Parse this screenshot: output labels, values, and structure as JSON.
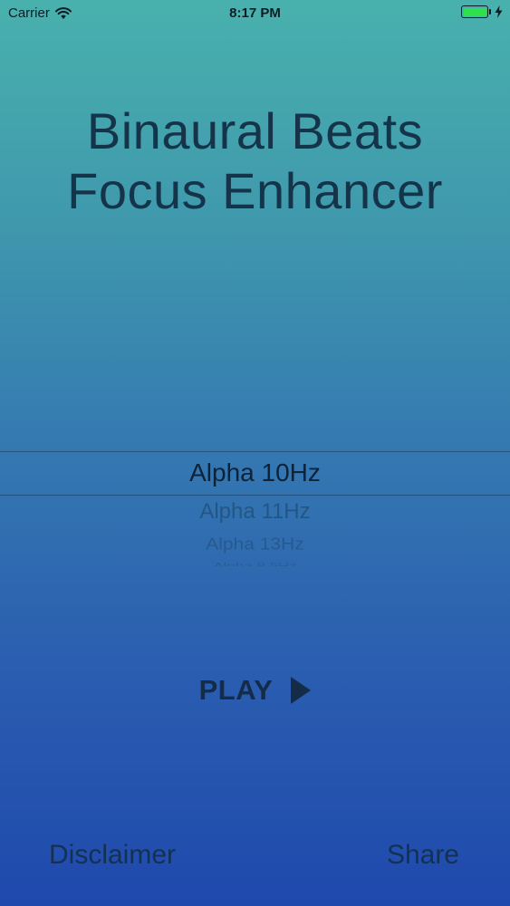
{
  "status_bar": {
    "carrier": "Carrier",
    "time": "8:17 PM",
    "battery_level": 1.0,
    "battery_color": "#2ee04a",
    "icons": [
      "wifi-icon",
      "battery-icon",
      "charging-bolt-icon"
    ]
  },
  "title": {
    "line1": "Binaural Beats",
    "line2": "Focus Enhancer"
  },
  "picker": {
    "selected": "Alpha 10Hz",
    "items": [
      "Alpha 10Hz",
      "Alpha 11Hz",
      "Alpha 13Hz",
      "Alpha 8.5Hz"
    ]
  },
  "play": {
    "label": "PLAY",
    "icon": "play-triangle-icon"
  },
  "footer": {
    "disclaimer_label": "Disclaimer",
    "share_label": "Share"
  },
  "colors": {
    "gradient_top": "#49b1ad",
    "gradient_bottom": "#1f49ad",
    "text_dark": "#15344a"
  }
}
